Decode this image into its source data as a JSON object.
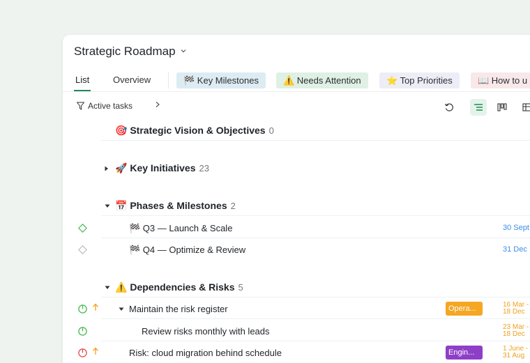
{
  "header": {
    "title": "Strategic Roadmap"
  },
  "tabs": {
    "list": "List",
    "overview": "Overview",
    "chips": {
      "milestones": "🏁 Key Milestones",
      "attention": "⚠️ Needs Attention",
      "priorities": "⭐ Top Priorities",
      "howto": "📖 How to u"
    }
  },
  "toolbar": {
    "filter_label": "Active tasks",
    "filter_icon": "filter-icon"
  },
  "groups": {
    "vision": {
      "icon": "🎯",
      "title": "Strategic Vision & Objectives",
      "count": "0"
    },
    "initiatives": {
      "icon": "🚀",
      "title": "Key Initiatives",
      "count": "23"
    },
    "phases": {
      "icon": "📅",
      "title": "Phases & Milestones",
      "count": "2"
    },
    "risks": {
      "icon": "⚠️",
      "title": "Dependencies & Risks",
      "count": "5"
    }
  },
  "tasks": {
    "q3": {
      "title": "🏁 Q3 — Launch & Scale",
      "date": "30 Sept"
    },
    "q4": {
      "title": "🏁 Q4 — Optimize & Review",
      "date": "31 Dec"
    },
    "register": {
      "title": "Maintain the risk register",
      "tag": "Opera...",
      "date_start": "16 Mar -",
      "date_end": "18 Dec"
    },
    "review": {
      "title": "Review risks monthly with leads",
      "date_start": "23 Mar -",
      "date_end": "18 Dec"
    },
    "cloud": {
      "title": "Risk: cloud migration behind schedule",
      "tag": "Engin...",
      "date_start": "1 June -",
      "date_end": "31 Aug"
    }
  },
  "colors": {
    "accent_green": "#1f8a55",
    "date_blue": "#3a8ee6",
    "date_orange": "#f0a020",
    "tag_orange": "#f5a623",
    "tag_purple": "#8e3fc7",
    "status_red": "#e5484d",
    "status_green": "#46b94f"
  }
}
